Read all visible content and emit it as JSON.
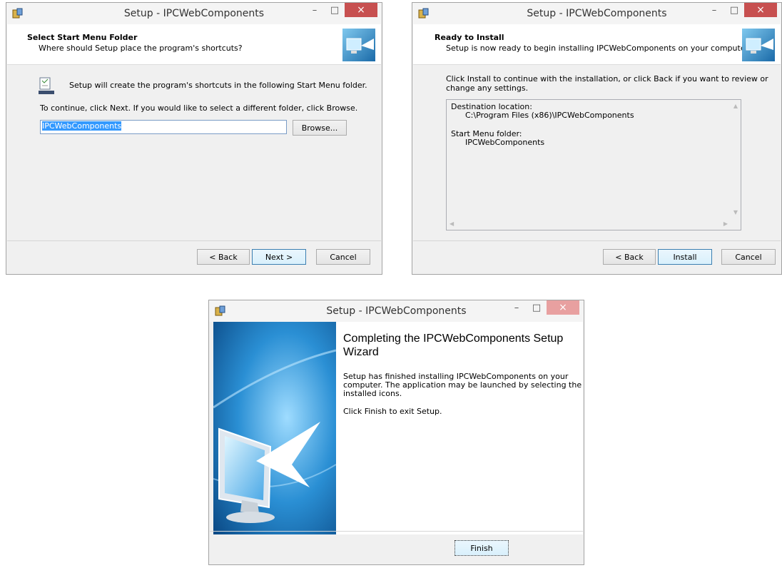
{
  "window1": {
    "title": "Setup - IPCWebComponents",
    "header_title": "Select Start Menu Folder",
    "header_subtitle": "Where should Setup place the program's shortcuts?",
    "info_text": "Setup will create the program's shortcuts in the following Start Menu folder.",
    "instruction": "To continue, click Next. If you would like to select a different folder, click Browse.",
    "folder_value": "IPCWebComponents",
    "browse_label": "Browse...",
    "back_label": "< Back",
    "next_label": "Next >",
    "cancel_label": "Cancel"
  },
  "window2": {
    "title": "Setup - IPCWebComponents",
    "header_title": "Ready to Install",
    "header_subtitle": "Setup is now ready to begin installing IPCWebComponents on your computer.",
    "instruction_line1": "Click Install to continue with the installation, or click Back if you want to review or",
    "instruction_line2": "change any settings.",
    "dest_label": "Destination location:",
    "dest_value": "C:\\Program Files (x86)\\IPCWebComponents",
    "menu_label": "Start Menu folder:",
    "menu_value": "IPCWebComponents",
    "back_label": "< Back",
    "install_label": "Install",
    "cancel_label": "Cancel"
  },
  "window3": {
    "title": "Setup - IPCWebComponents",
    "heading_line1": "Completing the IPCWebComponents Setup",
    "heading_line2": "Wizard",
    "para1_line1": "Setup has finished installing IPCWebComponents on your",
    "para1_line2": "computer. The application may be launched by selecting the",
    "para1_line3": "installed icons.",
    "para2": "Click Finish to exit Setup.",
    "finish_label": "Finish"
  },
  "window_controls": {
    "minimize": "–",
    "maximize": "□",
    "close": "×"
  },
  "icons": {
    "app": "setup-icon",
    "logo": "monitor-arrow-icon",
    "folder": "start-menu-folder-icon"
  },
  "colors": {
    "close_button": "#c75050",
    "selection": "#3399ff",
    "default_button_border": "#3c7fb1"
  }
}
